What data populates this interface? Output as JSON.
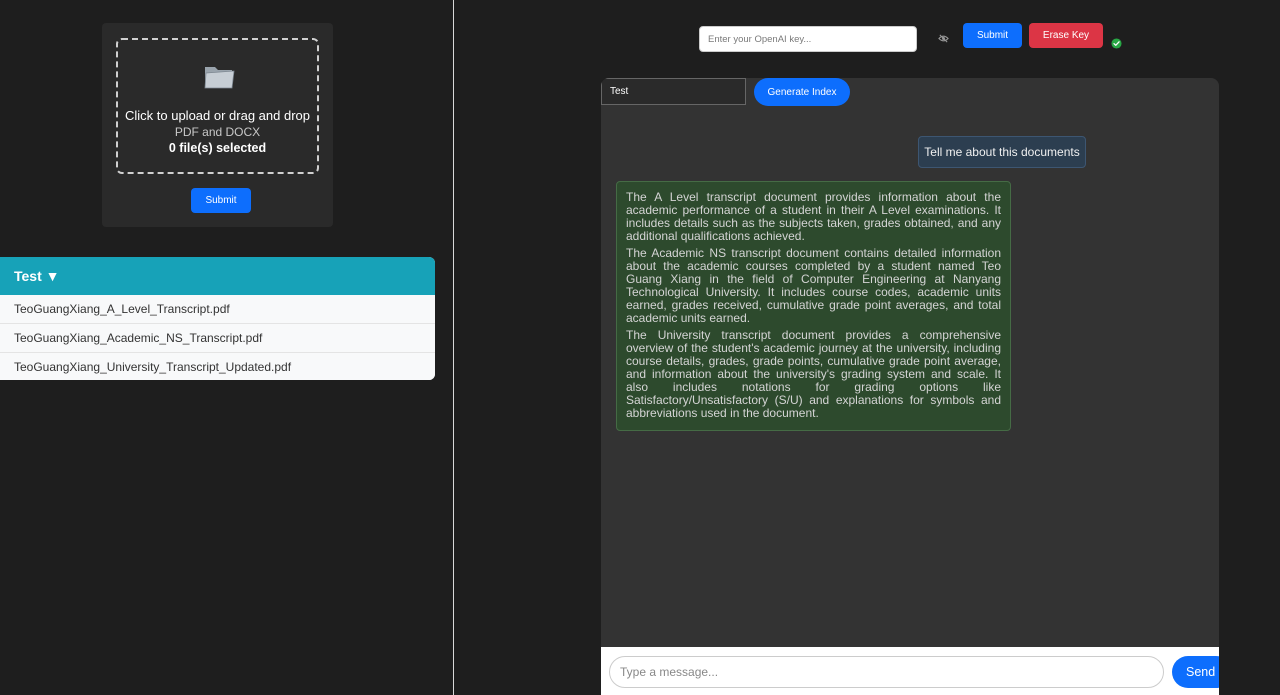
{
  "upload": {
    "line1": "Click to upload or drag and drop",
    "line2": "PDF and DOCX",
    "line3": "0 file(s) selected",
    "submit_label": "Submit"
  },
  "index_panel": {
    "header": "Test ▼",
    "files": [
      "TeoGuangXiang_A_Level_Transcript.pdf",
      "TeoGuangXiang_Academic_NS_Transcript.pdf",
      "TeoGuangXiang_University_Transcript_Updated.pdf"
    ]
  },
  "api_key": {
    "placeholder": "Enter your OpenAI key...",
    "submit_label": "Submit",
    "erase_label": "Erase Key"
  },
  "chat": {
    "index_name": "Test",
    "generate_label": "Generate Index",
    "user_message": "Tell me about this documents",
    "bot_paragraphs": [
      "The A Level transcript document provides information about the academic performance of a student in their A Level examinations. It includes details such as the subjects taken, grades obtained, and any additional qualifications achieved.",
      "The Academic NS transcript document contains detailed information about the academic courses completed by a student named Teo Guang Xiang in the field of Computer Engineering at Nanyang Technological University. It includes course codes, academic units earned, grades received, cumulative grade point averages, and total academic units earned.",
      "The University transcript document provides a comprehensive overview of the student's academic journey at the university, including course details, grades, grade points, cumulative grade point average, and information about the university's grading system and scale. It also includes notations for grading options like Satisfactory/Unsatisfactory (S/U) and explanations for symbols and abbreviations used in the document."
    ],
    "input_placeholder": "Type a message...",
    "send_label": "Send"
  },
  "icons": {
    "folder": "folder-icon",
    "eye": "eye-off-icon",
    "check": "check-circle-icon"
  },
  "colors": {
    "primary": "#0d6efd",
    "danger": "#dc3545",
    "info": "#17a2b8",
    "success": "#28a745"
  }
}
